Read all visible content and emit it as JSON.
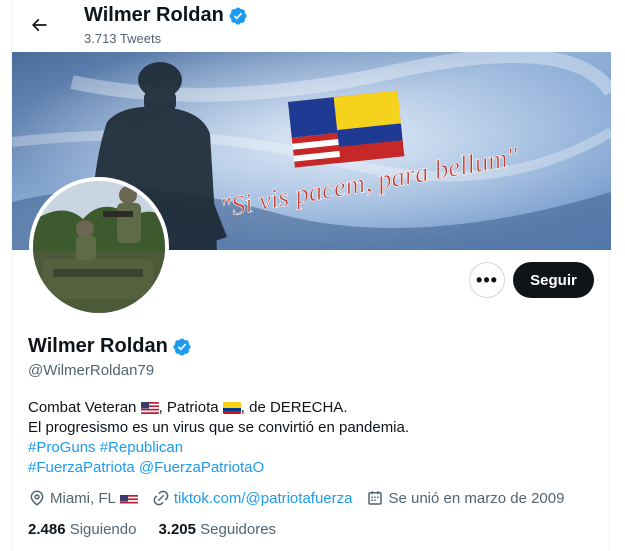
{
  "header": {
    "name": "Wilmer Roldan",
    "tweet_count": "3.713 Tweets"
  },
  "banner": {
    "quote": "\"Si vis pacem, para bellum\""
  },
  "actions": {
    "more_label": "•••",
    "follow_label": "Seguir"
  },
  "profile": {
    "name": "Wilmer Roldan",
    "handle": "@WilmerRoldan79"
  },
  "bio": {
    "line1_a": "Combat Veteran ",
    "line1_b": ", Patriota ",
    "line1_c": ", de DERECHA.",
    "line2": "El progresismo es un virus que se convirtió en pandemia.",
    "hashtag1": "#ProGuns",
    "hashtag2": "#Republican",
    "hashtag3": "#FuerzaPatriota",
    "mention": "@FuerzaPatriotaO"
  },
  "meta": {
    "location": "Miami, FL",
    "website": "tiktok.com/@patriotafuerza",
    "joined": "Se unió en marzo de 2009"
  },
  "stats": {
    "following_count": "2.486",
    "following_label": "Siguiendo",
    "followers_count": "3.205",
    "followers_label": "Seguidores"
  },
  "colors": {
    "accent": "#1d9bf0",
    "follow_bg": "#0f1419",
    "secondary_text": "#536471"
  },
  "icons": [
    "back-arrow-icon",
    "verified-badge-icon",
    "location-icon",
    "link-icon",
    "calendar-icon",
    "us-flag-icon",
    "colombia-flag-icon"
  ]
}
